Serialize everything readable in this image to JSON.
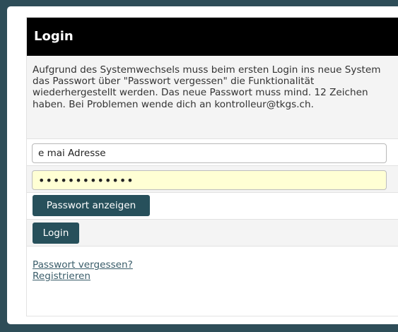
{
  "panel": {
    "title": "Login",
    "info": "Aufgrund des Systemwechsels muss beim ersten Login ins neue System das Passwort über \"Passwort vergessen\" die Funktionalität wiederhergestellt werden. Das neue Passwort muss mind. 12 Zeichen haben. Bei Problemen wende dich an kontrolleur@tkgs.ch."
  },
  "form": {
    "email_value": "e mai Adresse",
    "password_value": "•••••••••••••",
    "show_password_label": "Passwort anzeigen",
    "login_label": "Login"
  },
  "links": {
    "forgot_password": "Passwort vergessen?",
    "register": "Registrieren"
  },
  "colors": {
    "background": "#2e4d58",
    "header": "#000000",
    "button": "#27505b",
    "password_autofill": "#ffffd4"
  }
}
